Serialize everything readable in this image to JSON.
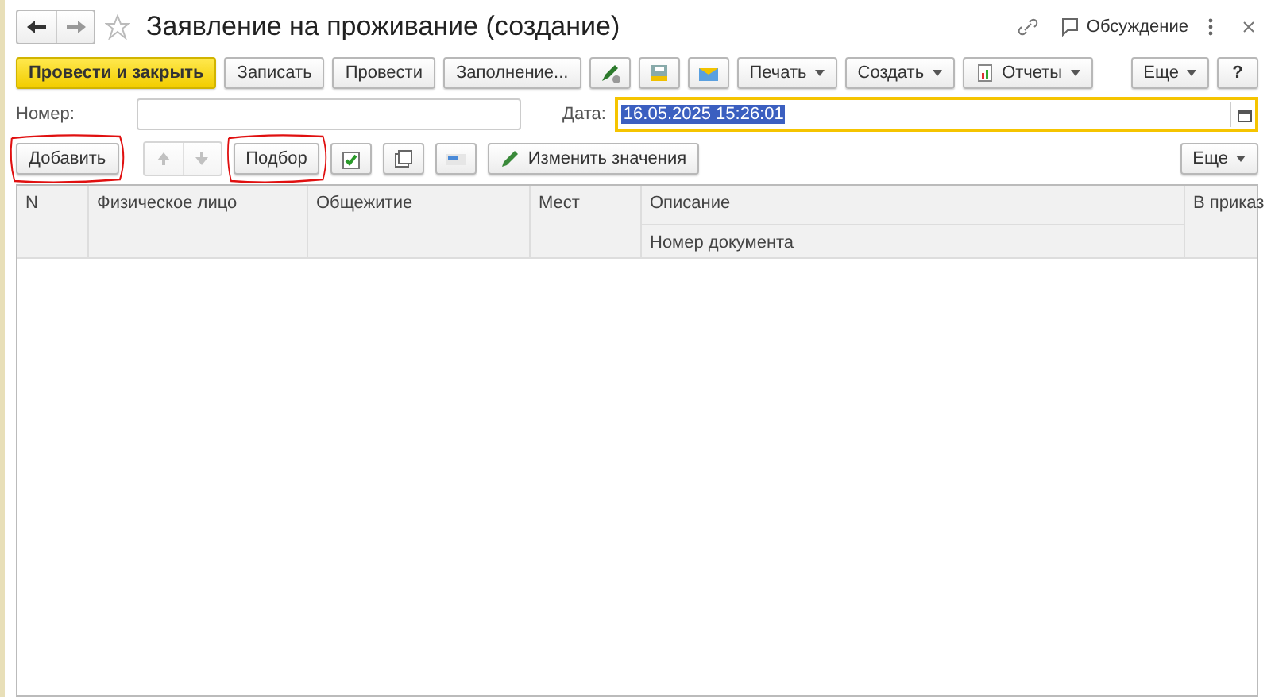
{
  "window": {
    "title": "Заявление на проживание (создание)",
    "discussion": "Обсуждение"
  },
  "toolbar": [
    {
      "label": "Провести и закрыть",
      "kind": "primary"
    },
    {
      "label": "Записать",
      "kind": "button"
    },
    {
      "label": "Провести",
      "kind": "button"
    },
    {
      "label": "Заполнение...",
      "kind": "button"
    },
    {
      "kind": "pen-icon"
    },
    {
      "kind": "save-icon"
    },
    {
      "kind": "mail-icon"
    },
    {
      "label": "Печать",
      "kind": "dropdown"
    },
    {
      "label": "Создать",
      "kind": "dropdown"
    },
    {
      "label": "Отчеты",
      "kind": "report"
    }
  ],
  "more": "Еще",
  "help": "?",
  "number": {
    "label": "Номер:"
  },
  "date": {
    "label": "Дата:",
    "value": "16.05.2025 15:26:01"
  },
  "table_toolbar": [
    {
      "label": "Добавить",
      "kind": "button",
      "circled": true
    },
    {
      "kind": "arrows"
    },
    {
      "label": "Подбор",
      "kind": "button",
      "circled": true
    },
    {
      "kind": "check-icon"
    },
    {
      "kind": "copy-icon"
    },
    {
      "kind": "card-icon"
    },
    {
      "label": "Изменить значения",
      "kind": "edit"
    }
  ],
  "table_more": "Еще",
  "table": {
    "columns": [
      "N",
      "Физическое лицо",
      "Общежитие",
      "Мест",
      "Описание",
      "В приказ"
    ],
    "subheader": "Номер документа"
  }
}
